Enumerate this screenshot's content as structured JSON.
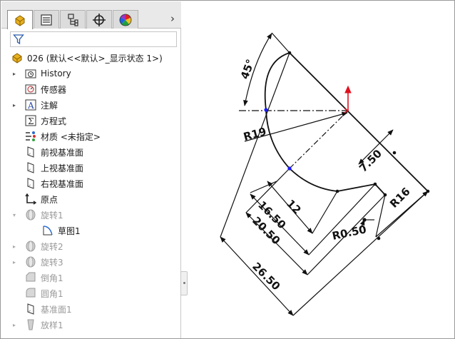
{
  "tabs": [
    {
      "name": "feature-manager",
      "icon": "feature-tree-icon",
      "active": true
    },
    {
      "name": "property-manager",
      "icon": "property-list-icon",
      "active": false
    },
    {
      "name": "configuration-manager",
      "icon": "configuration-icon",
      "active": false
    },
    {
      "name": "dimxpert-manager",
      "icon": "crosshair-icon",
      "active": false
    },
    {
      "name": "display-manager",
      "icon": "appearance-sphere-icon",
      "active": false
    }
  ],
  "tab_more_label": "›",
  "tree": {
    "root_label": "026  (默认<<默认>_显示状态 1>)",
    "items": [
      {
        "label": "History",
        "icon": "history-folder-icon",
        "expander": "▸",
        "dim": false
      },
      {
        "label": "传感器",
        "icon": "sensor-icon",
        "expander": "",
        "dim": false
      },
      {
        "label": "注解",
        "icon": "annotation-icon",
        "expander": "▸",
        "dim": false
      },
      {
        "label": "方程式",
        "icon": "equation-icon",
        "expander": "",
        "dim": false
      },
      {
        "label": "材质 <未指定>",
        "icon": "material-icon",
        "expander": "",
        "dim": false
      },
      {
        "label": "前视基准面",
        "icon": "plane-icon",
        "expander": "",
        "dim": false
      },
      {
        "label": "上视基准面",
        "icon": "plane-icon",
        "expander": "",
        "dim": false
      },
      {
        "label": "右视基准面",
        "icon": "plane-icon",
        "expander": "",
        "dim": false
      },
      {
        "label": "原点",
        "icon": "origin-icon",
        "expander": "",
        "dim": false
      },
      {
        "label": "旋转1",
        "icon": "revolve-icon",
        "expander": "▾",
        "dim": true
      },
      {
        "label": "草图1",
        "icon": "sketch-icon",
        "expander": "",
        "dim": false,
        "child": true
      },
      {
        "label": "旋转2",
        "icon": "revolve-icon",
        "expander": "▸",
        "dim": true
      },
      {
        "label": "旋转3",
        "icon": "revolve-icon",
        "expander": "▸",
        "dim": true
      },
      {
        "label": "倒角1",
        "icon": "chamfer-icon",
        "expander": "",
        "dim": true
      },
      {
        "label": "圆角1",
        "icon": "fillet-icon",
        "expander": "",
        "dim": true
      },
      {
        "label": "基准面1",
        "icon": "plane-icon",
        "expander": "",
        "dim": true
      },
      {
        "label": "放样1",
        "icon": "loft-icon",
        "expander": "▸",
        "dim": true
      }
    ]
  },
  "sketch": {
    "dimensions": {
      "angle": "45°",
      "r19": "R19",
      "d750": "7.50",
      "d12": "12",
      "d1650": "16.50",
      "d2050": "20.50",
      "r050": "R0.50",
      "r16": "R16",
      "d2650": "26.50"
    },
    "colors": {
      "line": "#111111",
      "axis_y": "#e0101e",
      "point": "#1a1aff"
    }
  }
}
